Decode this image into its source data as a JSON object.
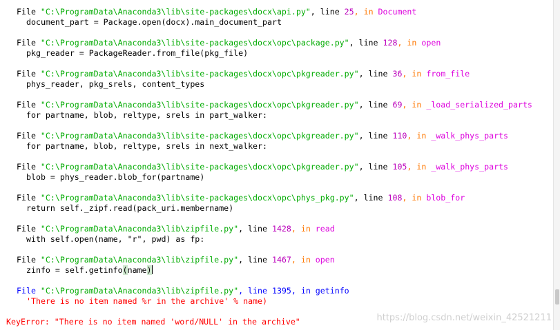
{
  "traceback": [
    {
      "file_prefix": "File ",
      "path": "\"C:\\ProgramData\\Anaconda3\\lib\\site-packages\\docx\\api.py\"",
      "line_label": ", line ",
      "line_no": "25",
      "in_label": ", in ",
      "func": "Document",
      "code": "document_part = Package.open(docx).main_document_part"
    },
    {
      "file_prefix": "File ",
      "path": "\"C:\\ProgramData\\Anaconda3\\lib\\site-packages\\docx\\opc\\package.py\"",
      "line_label": ", line ",
      "line_no": "128",
      "in_label": ", in ",
      "func": "open",
      "code": "pkg_reader = PackageReader.from_file(pkg_file)"
    },
    {
      "file_prefix": "File ",
      "path": "\"C:\\ProgramData\\Anaconda3\\lib\\site-packages\\docx\\opc\\pkgreader.py\"",
      "line_label": ", line ",
      "line_no": "36",
      "in_label": ", in ",
      "func": "from_file",
      "code": "phys_reader, pkg_srels, content_types"
    },
    {
      "file_prefix": "File ",
      "path": "\"C:\\ProgramData\\Anaconda3\\lib\\site-packages\\docx\\opc\\pkgreader.py\"",
      "line_label": ", line ",
      "line_no": "69",
      "in_label": ", in ",
      "func": "_load_serialized_parts",
      "code": "for partname, blob, reltype, srels in part_walker:"
    },
    {
      "file_prefix": "File ",
      "path": "\"C:\\ProgramData\\Anaconda3\\lib\\site-packages\\docx\\opc\\pkgreader.py\"",
      "line_label": ", line ",
      "line_no": "110",
      "in_label": ", in ",
      "func": "_walk_phys_parts",
      "code": "for partname, blob, reltype, srels in next_walker:"
    },
    {
      "file_prefix": "File ",
      "path": "\"C:\\ProgramData\\Anaconda3\\lib\\site-packages\\docx\\opc\\pkgreader.py\"",
      "line_label": ", line ",
      "line_no": "105",
      "in_label": ", in ",
      "func": "_walk_phys_parts",
      "code": "blob = phys_reader.blob_for(partname)"
    },
    {
      "file_prefix": "File ",
      "path": "\"C:\\ProgramData\\Anaconda3\\lib\\site-packages\\docx\\opc\\phys_pkg.py\"",
      "line_label": ", line ",
      "line_no": "108",
      "in_label": ", in ",
      "func": "blob_for",
      "code": "return self._zipf.read(pack_uri.membername)"
    },
    {
      "file_prefix": "File ",
      "path": "\"C:\\ProgramData\\Anaconda3\\lib\\zipfile.py\"",
      "line_label": ", line ",
      "line_no": "1428",
      "in_label": ", in ",
      "func": "read",
      "code": "with self.open(name, \"r\", pwd) as fp:"
    },
    {
      "file_prefix": "File ",
      "path": "\"C:\\ProgramData\\Anaconda3\\lib\\zipfile.py\"",
      "line_label": ", line ",
      "line_no": "1467",
      "in_label": ", in ",
      "func": "open",
      "code_before": "zinfo = self.getinfo",
      "code_paren_open": "(",
      "code_mid": "name",
      "code_paren_close": ")"
    },
    {
      "file_prefix": "File ",
      "path": "\"C:\\ProgramData\\Anaconda3\\lib\\zipfile.py\"",
      "line_label": ", line ",
      "line_no": "1395",
      "in_label": ", in ",
      "func": "getinfo",
      "code": "'There is no item named %r in the archive' % name)"
    }
  ],
  "error_line": "KeyError: \"There is no item named 'word/NULL' in the archive\"",
  "watermark": "https://blog.csdn.net/weixin_42521211",
  "colors": {
    "path_string": "#00aa00",
    "number": "#bb00bb",
    "keyword": "#ff7700",
    "function": "#dd00dd",
    "last_frame": "#0000ff",
    "error": "#ff0000"
  }
}
